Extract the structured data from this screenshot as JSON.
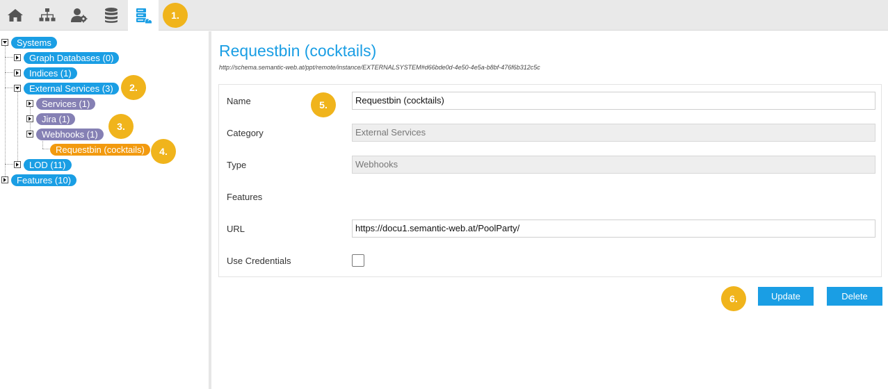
{
  "toolbar": {
    "buttons": [
      {
        "name": "home-icon"
      },
      {
        "name": "sitemap-icon"
      },
      {
        "name": "user-settings-icon"
      },
      {
        "name": "database-icon"
      },
      {
        "name": "external-systems-icon",
        "active": true
      }
    ]
  },
  "steps": [
    "1.",
    "2.",
    "3.",
    "4.",
    "5.",
    "6."
  ],
  "tree": {
    "systems": "Systems",
    "graph_databases": "Graph Databases (0)",
    "indices": "Indices (1)",
    "external_services": "External Services (3)",
    "services": "Services (1)",
    "jira": "Jira (1)",
    "webhooks": "Webhooks (1)",
    "requestbin": "Requestbin (cocktails)",
    "lod": "LOD (11)",
    "features": "Features (10)"
  },
  "main": {
    "title": "Requestbin (cocktails)",
    "uri": "http://schema.semantic-web.at/ppt/remote/instance/EXTERNALSYSTEM#d66bde0d-4e50-4e5a-b8bf-476f6b312c5c"
  },
  "form": {
    "name_label": "Name",
    "name_value": "Requestbin (cocktails)",
    "category_label": "Category",
    "category_value": "External Services",
    "type_label": "Type",
    "type_value": "Webhooks",
    "features_label": "Features",
    "url_label": "URL",
    "url_value": "https://docu1.semantic-web.at/PoolParty/",
    "credentials_label": "Use Credentials",
    "use_credentials": false
  },
  "actions": {
    "update_label": "Update",
    "delete_label": "Delete"
  },
  "colors": {
    "accent": "#1a9ee4",
    "secondary": "#8580b4",
    "selected": "#f29a0f",
    "step_badge": "#f0b41c"
  }
}
